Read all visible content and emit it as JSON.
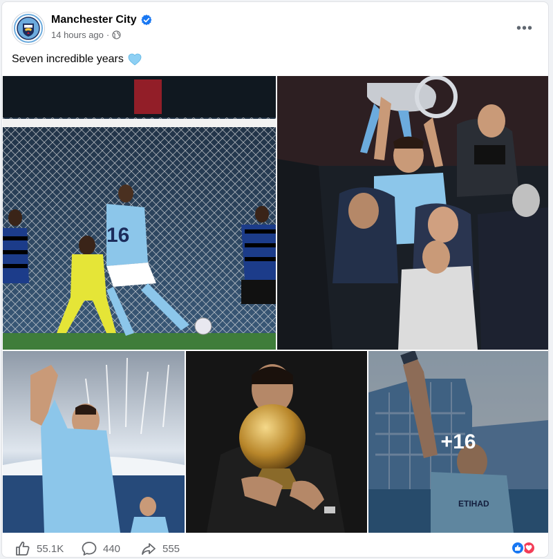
{
  "post": {
    "page_name": "Manchester City",
    "timestamp": "14 hours ago",
    "separator": "·",
    "caption": "Seven incredible years",
    "more_menu": "•••"
  },
  "photos": {
    "extra_count_label": "+16"
  },
  "footer": {
    "likes": "55.1K",
    "comments": "440",
    "shares": "555"
  },
  "colors": {
    "verified": "#1877f2",
    "like_blue": "#1877f2",
    "love_red": "#f33e58",
    "caption_heart": "#8ed0f4"
  },
  "icons": [
    "club-crest-icon",
    "verified-badge-icon",
    "globe-icon",
    "more-options-icon",
    "light-blue-heart-icon",
    "like-icon",
    "comment-icon",
    "share-icon",
    "like-reaction-icon",
    "love-reaction-icon"
  ]
}
